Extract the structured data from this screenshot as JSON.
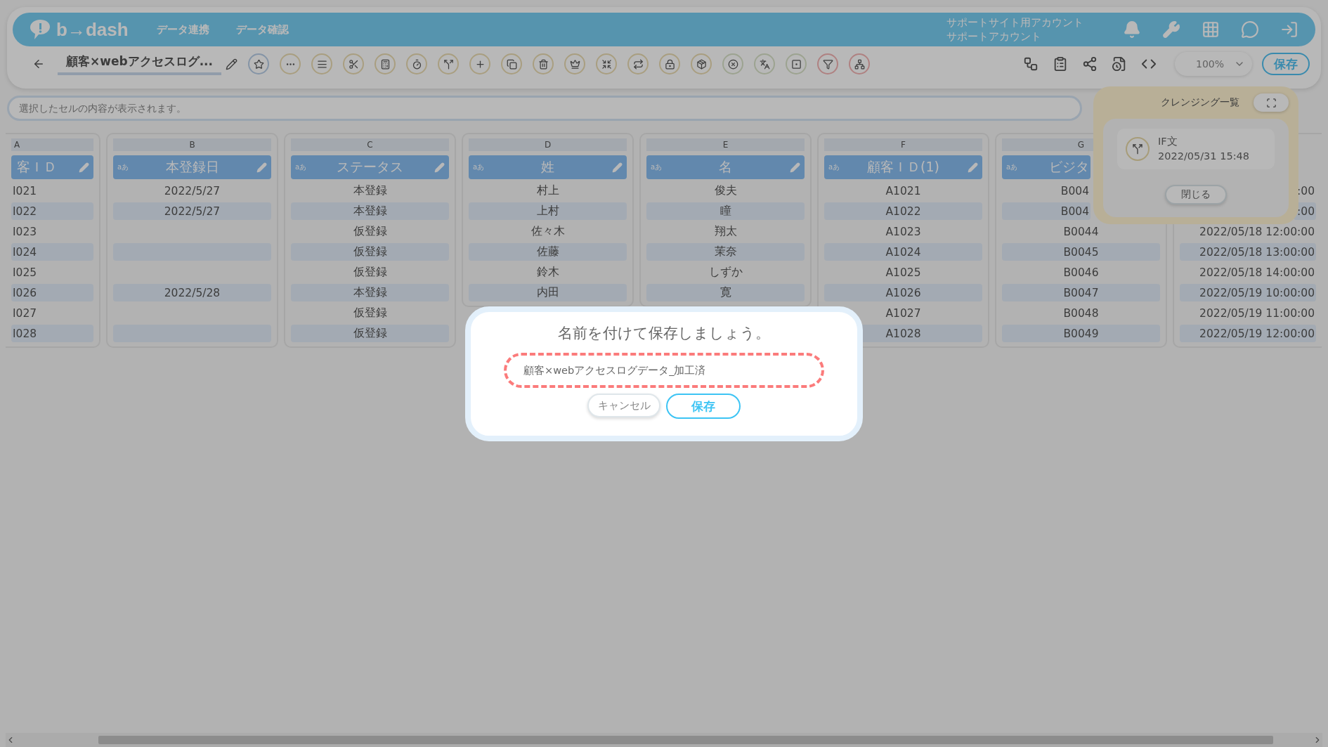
{
  "header": {
    "logo": "b→dash",
    "nav": [
      "データ連携",
      "データ確認"
    ],
    "account": [
      "サポートサイト用アカウント",
      "サポートアカウント"
    ]
  },
  "toolbar": {
    "title": "顧客×webアクセスログ...",
    "zoom": "100%",
    "save": "保存"
  },
  "formula_bar": {
    "placeholder": "選択したセルの内容が表示されます。"
  },
  "columns": [
    {
      "letter": "A",
      "header": "客ＩＤ",
      "cells": [
        "I021",
        "I022",
        "I023",
        "I024",
        "I025",
        "I026",
        "I027",
        "I028"
      ]
    },
    {
      "letter": "B",
      "header": "本登録日",
      "type": "aあ",
      "cells": [
        "2022/5/27",
        "2022/5/27",
        "",
        "",
        "",
        "2022/5/28",
        "",
        ""
      ]
    },
    {
      "letter": "C",
      "header": "ステータス",
      "type": "aあ",
      "cells": [
        "本登録",
        "本登録",
        "仮登録",
        "仮登録",
        "仮登録",
        "本登録",
        "仮登録",
        "仮登録"
      ]
    },
    {
      "letter": "D",
      "header": "姓",
      "type": "aあ",
      "cells": [
        "村上",
        "上村",
        "佐々木",
        "佐藤",
        "鈴木",
        "内田"
      ]
    },
    {
      "letter": "E",
      "header": "名",
      "type": "aあ",
      "cells": [
        "俊夫",
        "瞳",
        "翔太",
        "茉奈",
        "しずか",
        "寛"
      ]
    },
    {
      "letter": "F",
      "header": "顧客ＩＤ(1)",
      "type": "aあ",
      "cells": [
        "A1021",
        "A1022",
        "A1023",
        "A1024",
        "A1025",
        "A1026",
        "A1027",
        "A1028"
      ]
    },
    {
      "letter": "G",
      "header": "ビジタ",
      "type": "aあ",
      "cells": [
        "B004",
        "B004",
        "B0044",
        "B0045",
        "B0046",
        "B0047",
        "B0048",
        "B0049"
      ]
    },
    {
      "cells": [
        ":00",
        ":00",
        "2022/05/18 12:00:00",
        "2022/05/18 13:00:00",
        "2022/05/18 14:00:00",
        "2022/05/19 10:00:00",
        "2022/05/19 11:00:00",
        "2022/05/19 12:00:00"
      ]
    }
  ],
  "cleansing_panel": {
    "title": "クレンジング一覧",
    "items": [
      {
        "name": "IF文",
        "time": "2022/05/31 15:48"
      }
    ],
    "close": "閉じる"
  },
  "dialog": {
    "title": "名前を付けて保存しましょう。",
    "value": "顧客×webアクセスログデータ_加工済",
    "cancel": "キャンセル",
    "save": "保存"
  }
}
